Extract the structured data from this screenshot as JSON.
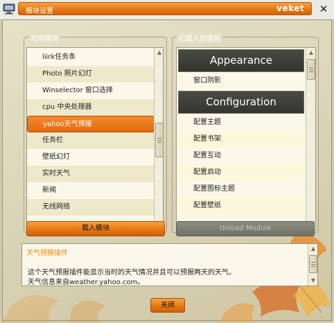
{
  "window": {
    "title": "模块设置",
    "brand": "veket"
  },
  "available": {
    "label": "可用模块",
    "items": [
      {
        "label": "liirk任务条"
      },
      {
        "label": "Photo 照片幻灯"
      },
      {
        "label": "Winselector 窗口选择"
      },
      {
        "label": "cpu 中央处理器"
      },
      {
        "label": "yahoo天气预报"
      },
      {
        "label": "任务栏"
      },
      {
        "label": "壁纸幻灯"
      },
      {
        "label": "实时天气"
      },
      {
        "label": "新闻"
      },
      {
        "label": "无线网络"
      }
    ],
    "selected": "yahoo天气预报",
    "load_button": "载入模块"
  },
  "loaded": {
    "label": "已载入的模块",
    "sections": [
      {
        "header": "Appearance",
        "items": [
          {
            "label": "窗口阴影"
          }
        ]
      },
      {
        "header": "Configuration",
        "items": [
          {
            "label": "配置主题"
          },
          {
            "label": "配置书架"
          },
          {
            "label": "配置互动"
          },
          {
            "label": "配置启动"
          },
          {
            "label": "配置图标主题"
          },
          {
            "label": "配置壁纸"
          }
        ]
      }
    ],
    "unload_button": "Unload Module"
  },
  "description": {
    "title": "天气预报插件",
    "line1": "这个天气预报插件能显示当时的天气情况并且可以预报两天的天气。",
    "line2": "天气信息来自weather.yahoo.com。"
  },
  "close_button": "关闭",
  "icons": [
    "computer-monitor-icon",
    "close-icon",
    "up-arrow-icon",
    "down-arrow-icon",
    "autumn-leaves-decoration"
  ],
  "colors": {
    "accent": "#e87a14",
    "header_dark": "#3b3b35",
    "desc_title": "#f08a14"
  }
}
